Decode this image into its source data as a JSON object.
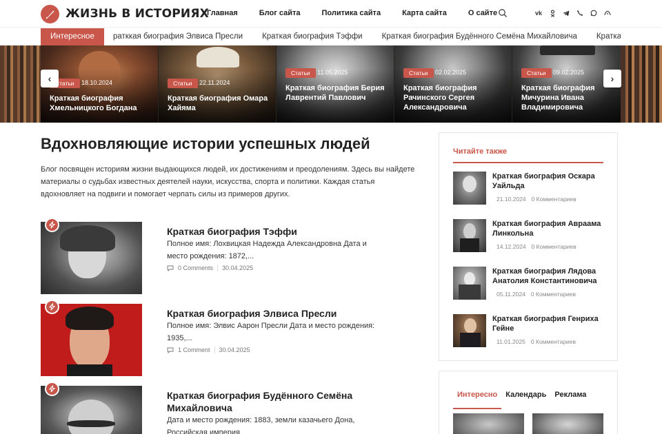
{
  "header": {
    "logo_text": "ЖИЗНЬ В ИСТОРИЯХ",
    "nav": [
      "Главная",
      "Блог сайта",
      "Политика сайта",
      "Карта сайта",
      "О сайте"
    ],
    "socials": [
      "vk-icon",
      "ok-icon",
      "telegram-icon",
      "viber-icon",
      "whatsapp-icon",
      "max-icon"
    ]
  },
  "ticker": {
    "label": "Интересное",
    "items": [
      "ратккая биография Элвиса Пресли",
      "Краткая биография Тэффи",
      "Краткая биография Будённого Семёна Михайловича",
      "Краткая биог"
    ]
  },
  "slider": {
    "slides": [
      {
        "badge": "Статьи",
        "date": "18.10.2024",
        "title": "Краткая биография Хмельницкого Богдана"
      },
      {
        "badge": "Статьи",
        "date": "22.11.2024",
        "title": "Краткая биография Омара Хайяма"
      },
      {
        "badge": "Статьи",
        "date": "11.05.2025",
        "title": "Краткая биография Берия Лаврентий Павлович"
      },
      {
        "badge": "Статьи",
        "date": "02.02.2025",
        "title": "Краткая биография Рачинского Сергея Александровича"
      },
      {
        "badge": "Статьи",
        "date": "09.02.2025",
        "title": "Краткая биография Мичурина Ивана Владимировича"
      }
    ],
    "prev": "‹",
    "next": "›"
  },
  "main": {
    "title": "Вдохновляющие истории успешных людей",
    "description": "Блог посвящен историям жизни выдающихся людей, их достижениям и преодолениям. Здесь вы найдете материалы о судьбах известных деятелей науки, искусства, спорта и политики. Каждая статья вдохновляет на подвиги и помогает черпать силы из примеров других.",
    "posts": [
      {
        "title": "Краткая биография Тэффи",
        "excerpt": "Полное имя: Лохвицкая Надежда Александровна Дата и место рождения: 1872,...",
        "comments": "0 Comments",
        "date": "30.04.2025"
      },
      {
        "title": "Краткая биография Элвиса Пресли",
        "excerpt": "Полное имя: Элвис Аарон Пресли Дата и место рождения: 1935,...",
        "comments": "1 Comment",
        "date": "30.04.2025"
      },
      {
        "title": "Краткая биография Будённого Семёна Михайловича",
        "excerpt": "Дата и место рождения: 1883, земли казачьего Дона, Российская империя",
        "comments": "",
        "date": ""
      }
    ]
  },
  "sidebar": {
    "read_also": {
      "title": "Читайте также",
      "items": [
        {
          "title": "Краткая биография Оскара Уайльда",
          "date": "21.10.2024",
          "comments": "0 Комментариев"
        },
        {
          "title": "Краткая биография Авраама Линкольна",
          "date": "14.12.2024",
          "comments": "0 Комментариев"
        },
        {
          "title": "Краткая биография Лядова Анатолия Константиновича",
          "date": "05.11.2024",
          "comments": "0 Комментариев"
        },
        {
          "title": "Краткая биография Генриха Гейне",
          "date": "11.01.2025",
          "comments": "0 Комментариев"
        }
      ]
    },
    "tabs": [
      "Интересно",
      "Календарь",
      "Реклама"
    ]
  },
  "colors": {
    "accent": "#c9564a",
    "text": "#222222",
    "muted": "#777777"
  }
}
